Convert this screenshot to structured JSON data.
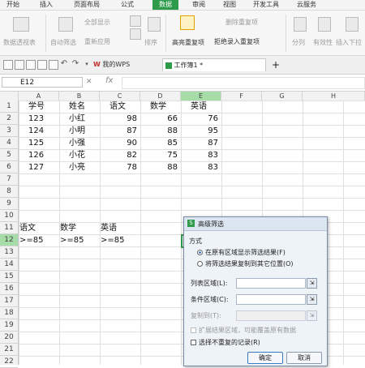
{
  "menu_tabs": [
    {
      "label": "开始"
    },
    {
      "label": "插入"
    },
    {
      "label": "页面布局"
    },
    {
      "label": "公式"
    },
    {
      "label": "数据",
      "active": true
    },
    {
      "label": "审阅"
    },
    {
      "label": "视图"
    },
    {
      "label": "开发工具"
    },
    {
      "label": "云服务"
    }
  ],
  "ribbon": {
    "pivot": "数据透视表",
    "auto_filter": "自动筛选",
    "show_all": "全部显示",
    "reapply": "重新应用",
    "sort": "排序",
    "highlight_dup": "高亮重复项",
    "remove_dup": "删除重复项",
    "reject_dup": "拒绝录入重复项",
    "split": "分列",
    "validity": "有效性",
    "insert_dropdown": "插入下拉"
  },
  "quickbar": {
    "doc_tab_1": "我的WPS",
    "doc_tab_2": "工作簿1 *",
    "add_tab": "+"
  },
  "formula_bar": {
    "name_box": "E12",
    "fx": "fx"
  },
  "columns": [
    "A",
    "B",
    "C",
    "D",
    "E",
    "F",
    "G",
    "H"
  ],
  "rows": [
    "1",
    "2",
    "3",
    "4",
    "5",
    "6",
    "7",
    "8",
    "9",
    "10",
    "11",
    "12",
    "13",
    "14",
    "15",
    "16",
    "17",
    "18",
    "19",
    "20",
    "21",
    "22"
  ],
  "table": {
    "headers": [
      "学号",
      "姓名",
      "语文",
      "数学",
      "英语"
    ],
    "records": [
      [
        "123",
        "小红",
        "98",
        "66",
        "76"
      ],
      [
        "124",
        "小明",
        "87",
        "88",
        "95"
      ],
      [
        "125",
        "小强",
        "90",
        "85",
        "87"
      ],
      [
        "126",
        "小花",
        "82",
        "75",
        "83"
      ],
      [
        "127",
        "小亮",
        "78",
        "88",
        "83"
      ]
    ]
  },
  "criteria": {
    "headers": [
      "语文",
      "数学",
      "英语"
    ],
    "values": [
      ">=85",
      ">=85",
      ">=85"
    ]
  },
  "dialog": {
    "title": "高级筛选",
    "section": "方式",
    "option_in_place": "在原有区域显示筛选结果(F)",
    "option_copy": "将筛选结果复制到其它位置(O)",
    "list_range_label": "列表区域(L):",
    "criteria_range_label": "条件区域(C):",
    "copy_to_label": "复制到(T):",
    "extend_label": "扩展结果区域，可能覆盖原有数据",
    "unique_label": "选择不重复的记录(R)",
    "ok": "确定",
    "cancel": "取消"
  },
  "colors": {
    "accent_green": "#2e9b4b",
    "selected_header": "#a6dca7"
  }
}
